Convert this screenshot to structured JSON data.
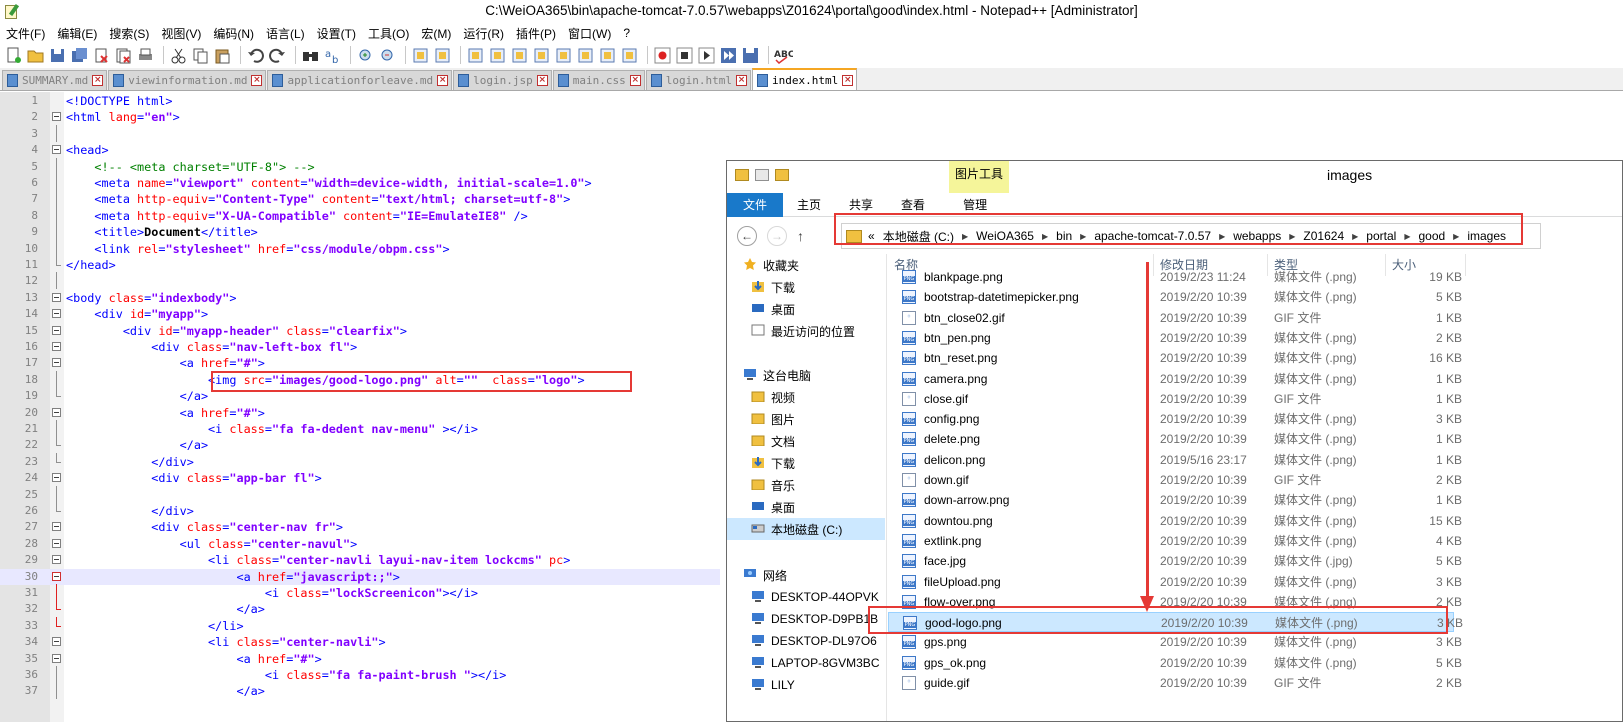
{
  "window": {
    "title": "C:\\WeiOA365\\bin\\apache-tomcat-7.0.57\\webapps\\Z01624\\portal\\good\\index.html - Notepad++ [Administrator]"
  },
  "menu": [
    "文件(F)",
    "编辑(E)",
    "搜索(S)",
    "视图(V)",
    "编码(N)",
    "语言(L)",
    "设置(T)",
    "工具(O)",
    "宏(M)",
    "运行(R)",
    "插件(P)",
    "窗口(W)",
    "?"
  ],
  "toolbar_icons": [
    "new-file-icon",
    "open-file-icon",
    "save-icon",
    "save-all-icon",
    "close-icon",
    "close-all-icon",
    "print-icon",
    "cut-icon",
    "copy-icon",
    "paste-icon",
    "undo-icon",
    "redo-icon",
    "find-icon",
    "replace-icon",
    "zoom-in-icon",
    "zoom-out-icon",
    "sync-vertical-icon",
    "sync-horizontal-icon",
    "word-wrap-icon",
    "show-all-chars-icon",
    "indent-guide-icon",
    "user-language-icon",
    "doc-map-icon",
    "function-list-icon",
    "folder-as-workspace-icon",
    "monitor-icon",
    "record-macro-icon",
    "stop-record-icon",
    "play-macro-icon",
    "run-macro-multiple-icon",
    "save-macro-icon",
    "spell-check-icon"
  ],
  "tabs": [
    {
      "label": "SUMMARY.md",
      "active": false
    },
    {
      "label": "viewinformation.md",
      "active": false
    },
    {
      "label": "applicationforleave.md",
      "active": false
    },
    {
      "label": "login.jsp",
      "active": false
    },
    {
      "label": "main.css",
      "active": false
    },
    {
      "label": "login.html",
      "active": false
    },
    {
      "label": "index.html",
      "active": true
    }
  ],
  "editor": {
    "current_line": 30,
    "highlighted_line": 18
  },
  "explorer": {
    "title": "images",
    "picture_tools": "图片工具",
    "ribbon_tabs": [
      "文件",
      "主页",
      "共享",
      "查看",
      "管理"
    ],
    "address_crumbs": [
      "本地磁盘 (C:)",
      "WeiOA365",
      "bin",
      "apache-tomcat-7.0.57",
      "webapps",
      "Z01624",
      "portal",
      "good",
      "images"
    ],
    "address_prefix": "«",
    "nav_items": [
      {
        "label": "收藏夹",
        "kind": "star"
      },
      {
        "label": "下载",
        "kind": "download"
      },
      {
        "label": "桌面",
        "kind": "desktop"
      },
      {
        "label": "最近访问的位置",
        "kind": "recent"
      },
      {
        "label": "这台电脑",
        "kind": "pc"
      },
      {
        "label": "视频",
        "kind": "folder"
      },
      {
        "label": "图片",
        "kind": "folder"
      },
      {
        "label": "文档",
        "kind": "folder"
      },
      {
        "label": "下载",
        "kind": "download"
      },
      {
        "label": "音乐",
        "kind": "folder"
      },
      {
        "label": "桌面",
        "kind": "desktop"
      },
      {
        "label": "本地磁盘 (C:)",
        "kind": "drive",
        "selected": true
      },
      {
        "label": "网络",
        "kind": "network"
      },
      {
        "label": "DESKTOP-44OPVK",
        "kind": "computer"
      },
      {
        "label": "DESKTOP-D9PB1B",
        "kind": "computer"
      },
      {
        "label": "DESKTOP-DL97O6",
        "kind": "computer"
      },
      {
        "label": "LAPTOP-8GVM3BC",
        "kind": "computer"
      },
      {
        "label": "LILY",
        "kind": "computer"
      }
    ],
    "columns": [
      "名称",
      "修改日期",
      "类型",
      "大小"
    ],
    "files": [
      {
        "name": "blankpage.png",
        "date": "2019/2/23 11:24",
        "type": "媒体文件 (.png)",
        "size": "19 KB",
        "icon": "png"
      },
      {
        "name": "bootstrap-datetimepicker.png",
        "date": "2019/2/20 10:39",
        "type": "媒体文件 (.png)",
        "size": "5 KB",
        "icon": "png"
      },
      {
        "name": "btn_close02.gif",
        "date": "2019/2/20 10:39",
        "type": "GIF 文件",
        "size": "1 KB",
        "icon": "gif"
      },
      {
        "name": "btn_pen.png",
        "date": "2019/2/20 10:39",
        "type": "媒体文件 (.png)",
        "size": "2 KB",
        "icon": "png"
      },
      {
        "name": "btn_reset.png",
        "date": "2019/2/20 10:39",
        "type": "媒体文件 (.png)",
        "size": "16 KB",
        "icon": "png"
      },
      {
        "name": "camera.png",
        "date": "2019/2/20 10:39",
        "type": "媒体文件 (.png)",
        "size": "1 KB",
        "icon": "png"
      },
      {
        "name": "close.gif",
        "date": "2019/2/20 10:39",
        "type": "GIF 文件",
        "size": "1 KB",
        "icon": "gif"
      },
      {
        "name": "config.png",
        "date": "2019/2/20 10:39",
        "type": "媒体文件 (.png)",
        "size": "3 KB",
        "icon": "png"
      },
      {
        "name": "delete.png",
        "date": "2019/2/20 10:39",
        "type": "媒体文件 (.png)",
        "size": "1 KB",
        "icon": "png"
      },
      {
        "name": "delicon.png",
        "date": "2019/5/16 23:17",
        "type": "媒体文件 (.png)",
        "size": "1 KB",
        "icon": "png"
      },
      {
        "name": "down.gif",
        "date": "2019/2/20 10:39",
        "type": "GIF 文件",
        "size": "2 KB",
        "icon": "gif"
      },
      {
        "name": "down-arrow.png",
        "date": "2019/2/20 10:39",
        "type": "媒体文件 (.png)",
        "size": "1 KB",
        "icon": "png"
      },
      {
        "name": "downtou.png",
        "date": "2019/2/20 10:39",
        "type": "媒体文件 (.png)",
        "size": "15 KB",
        "icon": "png"
      },
      {
        "name": "extlink.png",
        "date": "2019/2/20 10:39",
        "type": "媒体文件 (.png)",
        "size": "4 KB",
        "icon": "png"
      },
      {
        "name": "face.jpg",
        "date": "2019/2/20 10:39",
        "type": "媒体文件 (.jpg)",
        "size": "5 KB",
        "icon": "png"
      },
      {
        "name": "fileUpload.png",
        "date": "2019/2/20 10:39",
        "type": "媒体文件 (.png)",
        "size": "3 KB",
        "icon": "png"
      },
      {
        "name": "flow-over.png",
        "date": "2019/2/20 10:39",
        "type": "媒体文件 (.png)",
        "size": "2 KB",
        "icon": "png"
      },
      {
        "name": "good-logo.png",
        "date": "2019/2/20 10:39",
        "type": "媒体文件 (.png)",
        "size": "3 KB",
        "icon": "png",
        "selected": true
      },
      {
        "name": "gps.png",
        "date": "2019/2/20 10:39",
        "type": "媒体文件 (.png)",
        "size": "3 KB",
        "icon": "png"
      },
      {
        "name": "gps_ok.png",
        "date": "2019/2/20 10:39",
        "type": "媒体文件 (.png)",
        "size": "5 KB",
        "icon": "png"
      },
      {
        "name": "guide.gif",
        "date": "2019/2/20 10:39",
        "type": "GIF 文件",
        "size": "2 KB",
        "icon": "gif"
      }
    ]
  },
  "colors": {
    "annotation_red": "#e53935",
    "tag_blue": "#0000ff",
    "attr_red": "#ff0000",
    "value_purple": "#8000ff",
    "comment_green": "#008000",
    "selection_blue": "#cce8ff",
    "ribbon_file_blue": "#1979ca"
  }
}
